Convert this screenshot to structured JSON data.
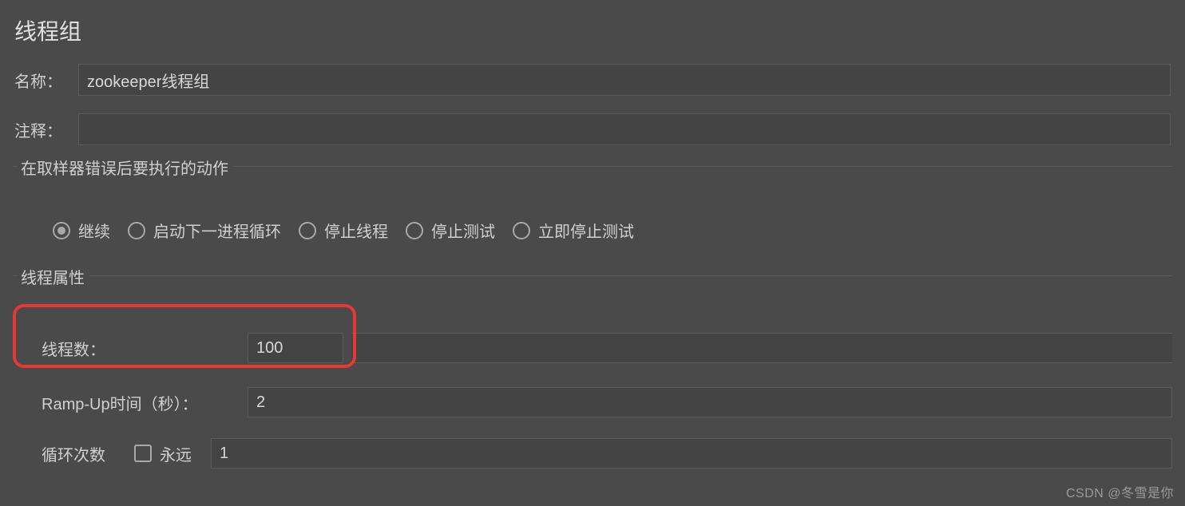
{
  "title": "线程组",
  "name_label": "名称：",
  "name_value": "zookeeper线程组",
  "comment_label": "注释：",
  "comment_value": "",
  "error_action": {
    "legend": "在取样器错误后要执行的动作",
    "options": [
      {
        "label": "继续",
        "selected": true
      },
      {
        "label": "启动下一进程循环",
        "selected": false
      },
      {
        "label": "停止线程",
        "selected": false
      },
      {
        "label": "停止测试",
        "selected": false
      },
      {
        "label": "立即停止测试",
        "selected": false
      }
    ]
  },
  "thread_props": {
    "legend": "线程属性",
    "threads_label": "线程数：",
    "threads_value": "100",
    "rampup_label": "Ramp-Up时间（秒）：",
    "rampup_value": "2",
    "loops_label": "循环次数",
    "forever_label": "永远",
    "forever_checked": false,
    "loops_value": "1"
  },
  "watermark": "CSDN @冬雪是你"
}
